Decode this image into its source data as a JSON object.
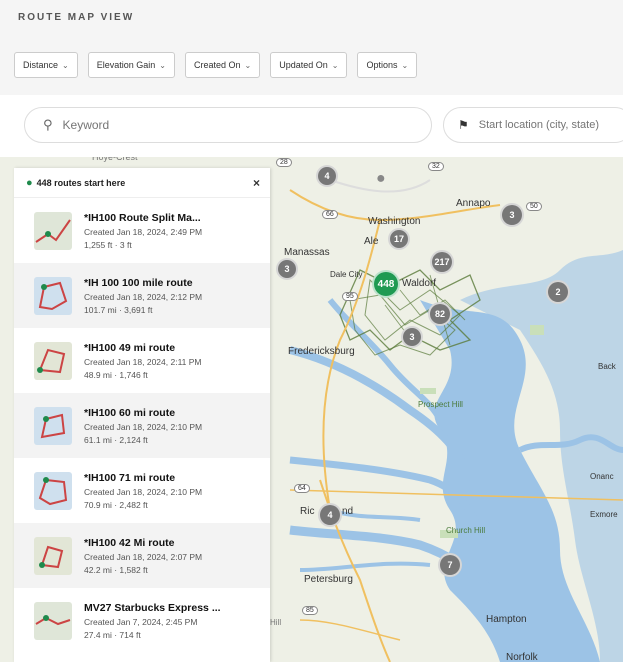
{
  "page": {
    "title": "ROUTE MAP VIEW"
  },
  "filters": [
    {
      "label": "Distance"
    },
    {
      "label": "Elevation Gain"
    },
    {
      "label": "Created On"
    },
    {
      "label": "Updated On"
    },
    {
      "label": "Options"
    }
  ],
  "search": {
    "keyword_placeholder": "Keyword",
    "location_placeholder": "Start location (city, state)"
  },
  "sidebar": {
    "header": "448 routes start here",
    "routes": [
      {
        "title": "*IH100 Route Split Ma...",
        "created": "Created Jan 18, 2024, 2:49 PM",
        "stats": "1,255 ft · 3 ft"
      },
      {
        "title": "*IH 100 100 mile route",
        "created": "Created Jan 18, 2024, 2:12 PM",
        "stats": "101.7 mi · 3,691 ft"
      },
      {
        "title": "*IH100 49 mi route",
        "created": "Created Jan 18, 2024, 2:11 PM",
        "stats": "48.9 mi · 1,746 ft"
      },
      {
        "title": "*IH100 60 mi route",
        "created": "Created Jan 18, 2024, 2:10 PM",
        "stats": "61.1 mi · 2,124 ft"
      },
      {
        "title": "*IH100 71 mi route",
        "created": "Created Jan 18, 2024, 2:10 PM",
        "stats": "70.9 mi · 2,482 ft"
      },
      {
        "title": "*IH100 42 Mi route",
        "created": "Created Jan 18, 2024, 2:07 PM",
        "stats": "42.2 mi · 1,582 ft"
      },
      {
        "title": "MV27 Starbucks Express ...",
        "created": "Created Jan 7, 2024, 2:45 PM",
        "stats": "27.4 mi · 714 ft"
      }
    ]
  },
  "map": {
    "place_labels": {
      "hoye_crest": "Hoye-Crest",
      "washington": "Washington",
      "alexandria": "Ale",
      "annapolis": "Annapo",
      "manassas": "Manassas",
      "dale_city": "Dale City",
      "waldorf": "Waldorf",
      "fredericksburg": "Fredericksburg",
      "prospect_hill": "Prospect Hill",
      "richmond": "Ric",
      "richmond_end": "nd",
      "church_hill": "Church Hill",
      "petersburg": "Petersburg",
      "hampton": "Hampton",
      "norfolk": "Norfolk",
      "onanc": "Onanc",
      "exmore": "Exmore",
      "back": "Back",
      "hill": "Hill"
    },
    "highway_shields": {
      "i66": "66",
      "i95": "95",
      "r301": "301",
      "r50": "50",
      "r28": "28",
      "r32": "32",
      "r64": "64",
      "r85": "85"
    },
    "clusters": {
      "c4_top": "4",
      "c3_annapolis": "3",
      "c17": "17",
      "c217": "217",
      "c3_manassas": "3",
      "c448": "448",
      "c2": "2",
      "c82": "82",
      "c3_south": "3",
      "c4_richmond": "4",
      "c7": "7"
    },
    "colors": {
      "water": "#9cc3e6",
      "land": "#eef0e6",
      "cluster": "#777777",
      "selected_cluster": "#1f9a52"
    }
  }
}
